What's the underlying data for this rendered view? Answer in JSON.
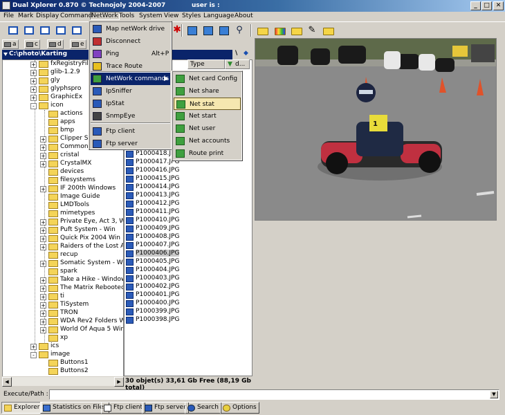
{
  "window": {
    "title": "Dual Xplorer 0.870  © Technojoly 2004-2007",
    "user_label": "user is :",
    "controls": [
      "_",
      "□",
      "✕"
    ]
  },
  "menubar": [
    "File",
    "Mark",
    "Display",
    "Command",
    "NetWork",
    "Tools",
    "System",
    "View",
    "Styles",
    "Language",
    "About"
  ],
  "toolbar": {
    "icons": [
      "panel-single-icon",
      "panel-split-icon",
      "panel-copy-icon",
      "panel-compare-icon",
      "panel-view-icon",
      "star-icon",
      "sync-icon",
      "image-view-icon",
      "book-icon",
      "binoculars-icon",
      "folder-icon",
      "paint-folder-icon",
      "folder-icon",
      "wrench-icon",
      "folder-icon"
    ]
  },
  "drives": [
    "a",
    "c",
    "d",
    "e"
  ],
  "path": "C:\\photo\\Karting",
  "tree": [
    {
      "label": "fxRegistryFile",
      "level": 3,
      "pm": "+"
    },
    {
      "label": "glib-1.2.9",
      "level": 3,
      "pm": "+"
    },
    {
      "label": "gly",
      "level": 3,
      "pm": "+"
    },
    {
      "label": "glyphspro",
      "level": 3,
      "pm": "+"
    },
    {
      "label": "GraphicEx",
      "level": 3,
      "pm": "+"
    },
    {
      "label": "icon",
      "level": 3,
      "pm": "-"
    },
    {
      "label": "actions",
      "level": 4,
      "pm": ""
    },
    {
      "label": "apps",
      "level": 4,
      "pm": ""
    },
    {
      "label": "bmp",
      "level": 4,
      "pm": ""
    },
    {
      "label": "Clipper Syst",
      "level": 4,
      "pm": "+"
    },
    {
      "label": "Common",
      "level": 4,
      "pm": "+"
    },
    {
      "label": "cristal",
      "level": 4,
      "pm": "+"
    },
    {
      "label": "CrystalMX",
      "level": 4,
      "pm": "+"
    },
    {
      "label": "devices",
      "level": 4,
      "pm": ""
    },
    {
      "label": "filesystems",
      "level": 4,
      "pm": ""
    },
    {
      "label": "IF 200th Windows",
      "level": 4,
      "pm": "+"
    },
    {
      "label": "Image Guide",
      "level": 4,
      "pm": ""
    },
    {
      "label": "LMDTools",
      "level": 4,
      "pm": ""
    },
    {
      "label": "mimetypes",
      "level": 4,
      "pm": ""
    },
    {
      "label": "Private Eye, Act 3, Wi",
      "level": 4,
      "pm": "+"
    },
    {
      "label": "Puft System - Win",
      "level": 4,
      "pm": "+"
    },
    {
      "label": "Quick Pix 2004 Win",
      "level": 4,
      "pm": "+"
    },
    {
      "label": "Raiders of the Lost Ark",
      "level": 4,
      "pm": "+"
    },
    {
      "label": "recup",
      "level": 4,
      "pm": ""
    },
    {
      "label": "Somatic System - Win",
      "level": 4,
      "pm": "+"
    },
    {
      "label": "spark",
      "level": 4,
      "pm": ""
    },
    {
      "label": "Take a Hike - Window",
      "level": 4,
      "pm": "+"
    },
    {
      "label": "The Matrix Rebooted '",
      "level": 4,
      "pm": "+"
    },
    {
      "label": "ti",
      "level": 4,
      "pm": "+"
    },
    {
      "label": "TiSystem",
      "level": 4,
      "pm": "+"
    },
    {
      "label": "TRON",
      "level": 4,
      "pm": "+"
    },
    {
      "label": "WDA Rev2 Folders W",
      "level": 4,
      "pm": "+"
    },
    {
      "label": "World Of Aqua 5 Win",
      "level": 4,
      "pm": "+"
    },
    {
      "label": "xp",
      "level": 4,
      "pm": ""
    },
    {
      "label": "ics",
      "level": 3,
      "pm": "+"
    },
    {
      "label": "image",
      "level": 3,
      "pm": "-"
    },
    {
      "label": "Buttons1",
      "level": 4,
      "pm": ""
    },
    {
      "label": "Buttons2",
      "level": 4,
      "pm": ""
    }
  ],
  "files": {
    "columns": [
      "Type",
      "d..."
    ],
    "items": [
      "P1000418.JPG",
      "P1000417.JPG",
      "P1000416.JPG",
      "P1000415.JPG",
      "P1000414.JPG",
      "P1000413.JPG",
      "P1000412.JPG",
      "P1000411.JPG",
      "P1000410.JPG",
      "P1000409.JPG",
      "P1000408.JPG",
      "P1000407.JPG",
      "P1000406.JPG",
      "P1000405.JPG",
      "P1000404.JPG",
      "P1000403.JPG",
      "P1000402.JPG",
      "P1000401.JPG",
      "P1000400.JPG",
      "P1000399.JPG",
      "P1000398.JPG"
    ],
    "selected_index": 12,
    "status": "30 objet(s) 33,61 Gb Free (88,19 Gb total)"
  },
  "network_menu": [
    {
      "label": "Map netWork drive",
      "icon": "map-drive-icon",
      "shortcut": ""
    },
    {
      "label": "Disconnect",
      "icon": "disconnect-icon",
      "shortcut": ""
    },
    {
      "label": "Ping",
      "icon": "ping-icon",
      "shortcut": "Alt+P"
    },
    {
      "label": "Trace Route",
      "icon": "trace-route-icon",
      "shortcut": ""
    },
    {
      "label": "NetWork commands",
      "icon": "network-icon",
      "shortcut": ""
    },
    {
      "label": "IpSniffer",
      "icon": "monitor-icon",
      "shortcut": ""
    },
    {
      "label": "IpStat",
      "icon": "ipstat-icon",
      "shortcut": ""
    },
    {
      "label": "SnmpEye",
      "icon": "snmp-icon",
      "shortcut": ""
    },
    {
      "label": "Ftp client",
      "icon": "ftp-client-icon",
      "shortcut": ""
    },
    {
      "label": "Ftp server",
      "icon": "ftp-server-icon",
      "shortcut": ""
    }
  ],
  "network_submenu": [
    "Net card Config",
    "Net share",
    "Net stat",
    "Net start",
    "Net user",
    "Net accounts",
    "Route print"
  ],
  "exec": {
    "label": "Execute/Path :",
    "value": ""
  },
  "tabs": [
    "Explorer",
    "Statistics on Files",
    "Ftp client",
    "Ftp server",
    "Search",
    "Options"
  ],
  "colors": {
    "titlebar": "#0a246a",
    "highlight": "#0a246a",
    "net_icon": "#3fa03f"
  }
}
